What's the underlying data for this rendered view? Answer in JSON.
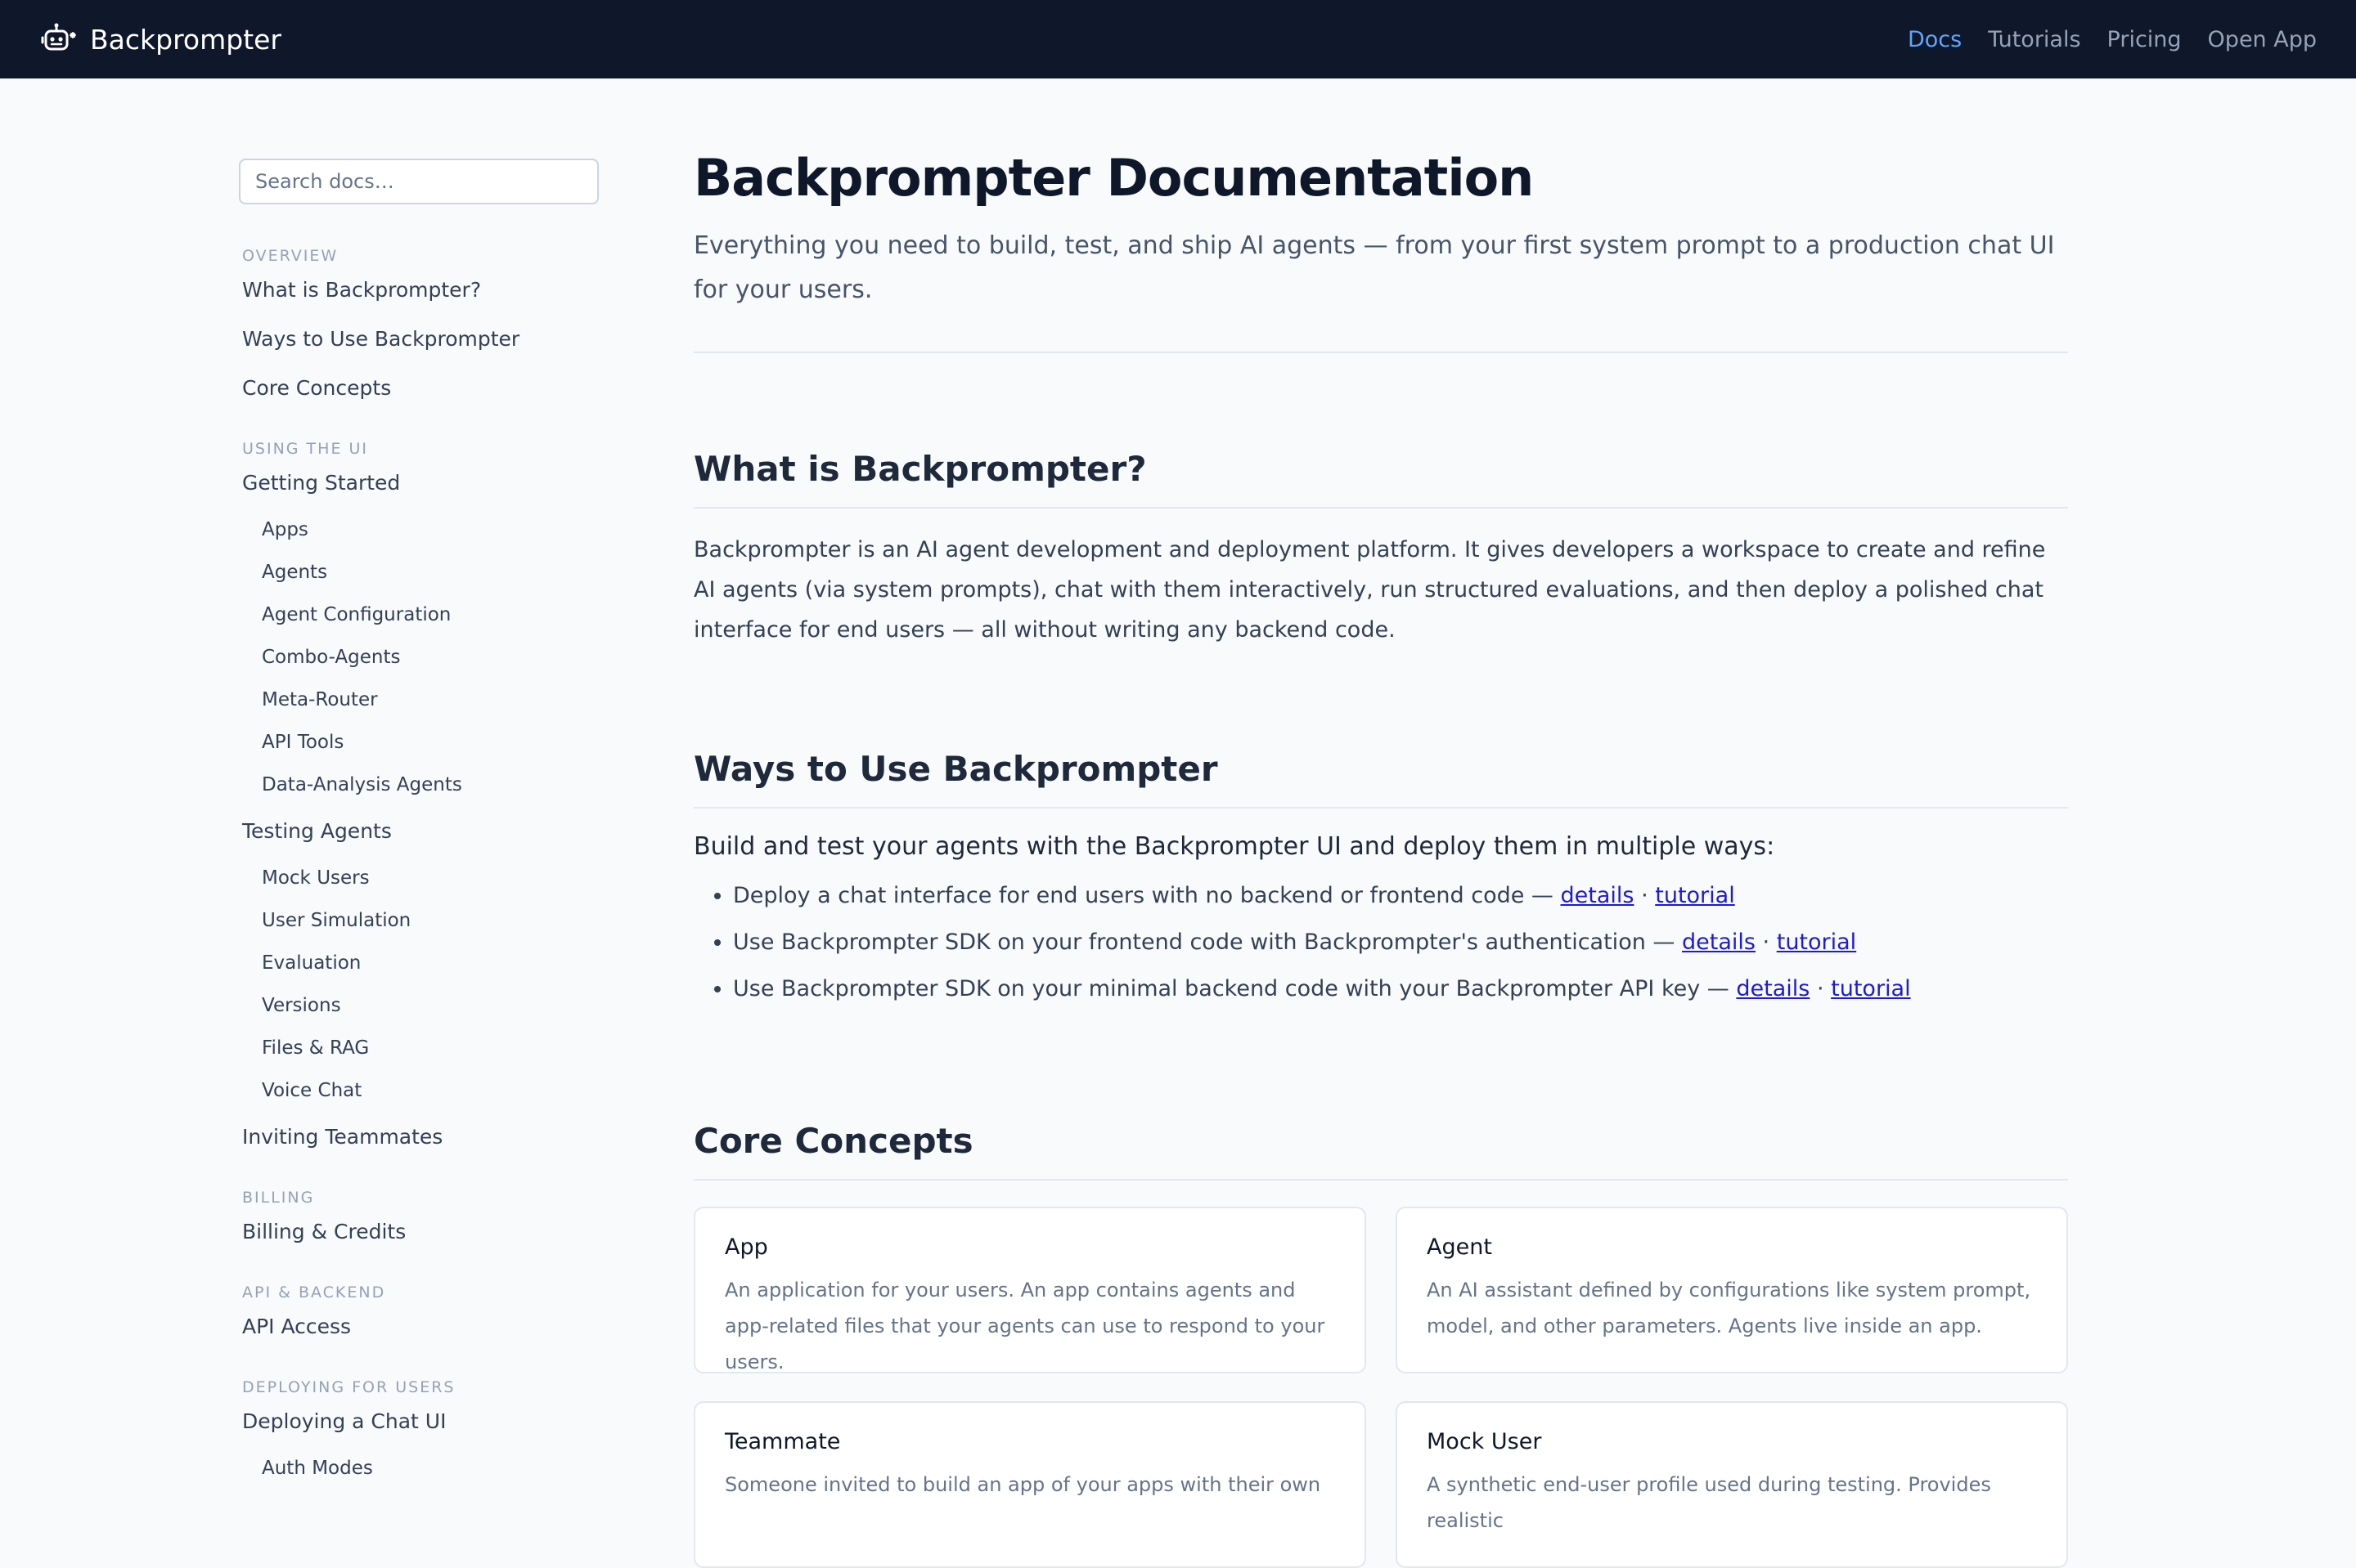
{
  "header": {
    "brand": "Backprompter",
    "nav": [
      {
        "label": "Docs",
        "active": true
      },
      {
        "label": "Tutorials",
        "active": false
      },
      {
        "label": "Pricing",
        "active": false
      },
      {
        "label": "Open App",
        "active": false
      }
    ]
  },
  "sidebar": {
    "search_placeholder": "Search docs…",
    "sections": [
      {
        "title": "OVERVIEW",
        "items": [
          "What is Backprompter?",
          "Ways to Use Backprompter",
          "Core Concepts"
        ]
      },
      {
        "title": "USING THE UI",
        "groups": [
          {
            "label": "Getting Started",
            "subs": [
              "Apps",
              "Agents",
              "Agent Configuration",
              "Combo-Agents",
              "Meta-Router",
              "API Tools",
              "Data-Analysis Agents"
            ]
          },
          {
            "label": "Testing Agents",
            "subs": [
              "Mock Users",
              "User Simulation",
              "Evaluation",
              "Versions",
              "Files & RAG",
              "Voice Chat"
            ]
          },
          {
            "label": "Inviting Teammates",
            "subs": []
          }
        ]
      },
      {
        "title": "BILLING",
        "items": [
          "Billing & Credits"
        ]
      },
      {
        "title": "API & BACKEND",
        "items": [
          "API Access"
        ]
      },
      {
        "title": "DEPLOYING FOR USERS",
        "groups": [
          {
            "label": "Deploying a Chat UI",
            "subs": [
              "Auth Modes"
            ]
          }
        ]
      }
    ]
  },
  "main": {
    "title": "Backprompter Documentation",
    "subtitle": "Everything you need to build, test, and ship AI agents — from your first system prompt to a production chat UI for your users.",
    "what": {
      "heading": "What is Backprompter?",
      "body": "Backprompter is an AI agent development and deployment platform. It gives developers a workspace to create and refine AI agents (via system prompts), chat with them interactively, run structured evaluations, and then deploy a polished chat interface for end users — all without writing any backend code."
    },
    "ways": {
      "heading": "Ways to Use Backprompter",
      "lead": "Build and test your agents with the Backprompter UI and deploy them in multiple ways:",
      "items": [
        {
          "text": "Deploy a chat interface for end users with no backend or frontend code —",
          "details": "details",
          "sep": "·",
          "tutorial": "tutorial"
        },
        {
          "text": "Use Backprompter SDK on your frontend code with Backprompter's authentication —",
          "details": "details",
          "sep": "·",
          "tutorial": "tutorial"
        },
        {
          "text": "Use Backprompter SDK on your minimal backend code with your Backprompter API key —",
          "details": "details",
          "sep": "·",
          "tutorial": "tutorial"
        }
      ]
    },
    "concepts": {
      "heading": "Core Concepts",
      "cards": [
        {
          "title": "App",
          "desc": "An application for your users. An app contains agents and app-related files that your agents can use to respond to your users."
        },
        {
          "title": "Agent",
          "desc": "An AI assistant defined by configurations like system prompt, model, and other parameters. Agents live inside an app."
        },
        {
          "title": "Teammate",
          "desc": "Someone invited to build an app of your apps with their own"
        },
        {
          "title": "Mock User",
          "desc": "A synthetic end-user profile used during testing. Provides realistic"
        }
      ]
    }
  }
}
